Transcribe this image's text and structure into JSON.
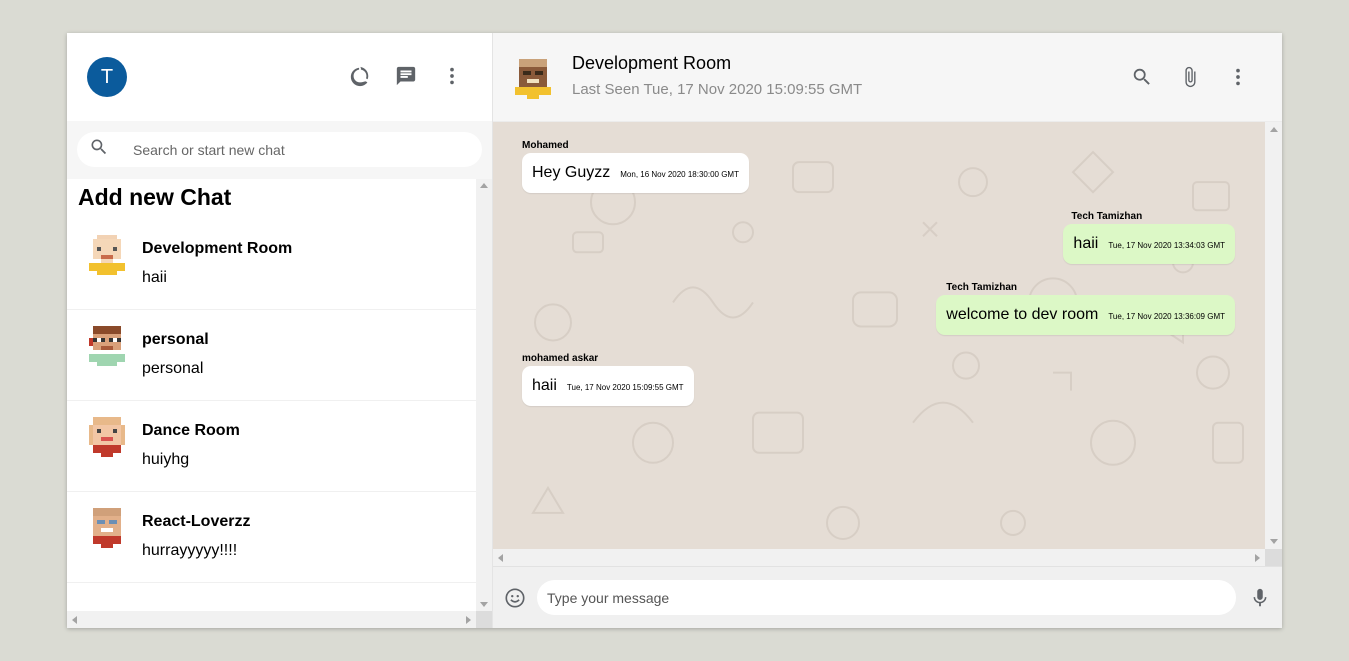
{
  "colors": {
    "page_bg": "#dadbd3",
    "avatar_bg": "#0b5b9c",
    "header_bg": "#f6f6f6",
    "chat_bg": "#e5ddd5",
    "bubble_incoming": "#ffffff",
    "bubble_outgoing": "#dcf8c6",
    "icon_color": "#5f6368"
  },
  "sidebar": {
    "user_avatar_letter": "T",
    "icons": [
      "status-icon",
      "new-chat-icon",
      "more-vert-icon"
    ],
    "search": {
      "placeholder": "Search or start new chat",
      "value": ""
    },
    "add_chat_label": "Add new Chat",
    "chats": [
      {
        "name": "Development Room",
        "last_message": "haii",
        "avatar": "pixel-avatar-bald"
      },
      {
        "name": "personal",
        "last_message": "personal",
        "avatar": "pixel-avatar-glasses"
      },
      {
        "name": "Dance Room",
        "last_message": "huiyhg",
        "avatar": "pixel-avatar-blonde"
      },
      {
        "name": "React-Loverzz",
        "last_message": "hurrayyyyy!!!!",
        "avatar": "pixel-avatar-red-shirt"
      }
    ]
  },
  "chat": {
    "title": "Development Room",
    "subtitle": "Last Seen Tue, 17 Nov 2020 15:09:55 GMT",
    "header_icons": [
      "search-icon",
      "attach-icon",
      "more-vert-icon"
    ],
    "messages": [
      {
        "sender": "Mohamed",
        "text": "Hey Guyzz",
        "timestamp": "Mon, 16 Nov 2020 18:30:00 GMT",
        "mine": false
      },
      {
        "sender": "Tech Tamizhan",
        "text": "haii",
        "timestamp": "Tue, 17 Nov 2020 13:34:03 GMT",
        "mine": true
      },
      {
        "sender": "Tech Tamizhan",
        "text": "welcome to dev room",
        "timestamp": "Tue, 17 Nov 2020 13:36:09 GMT",
        "mine": true
      },
      {
        "sender": "mohamed askar",
        "text": "haii",
        "timestamp": "Tue, 17 Nov 2020 15:09:55 GMT",
        "mine": false
      }
    ],
    "input": {
      "placeholder": "Type your message",
      "value": ""
    }
  }
}
